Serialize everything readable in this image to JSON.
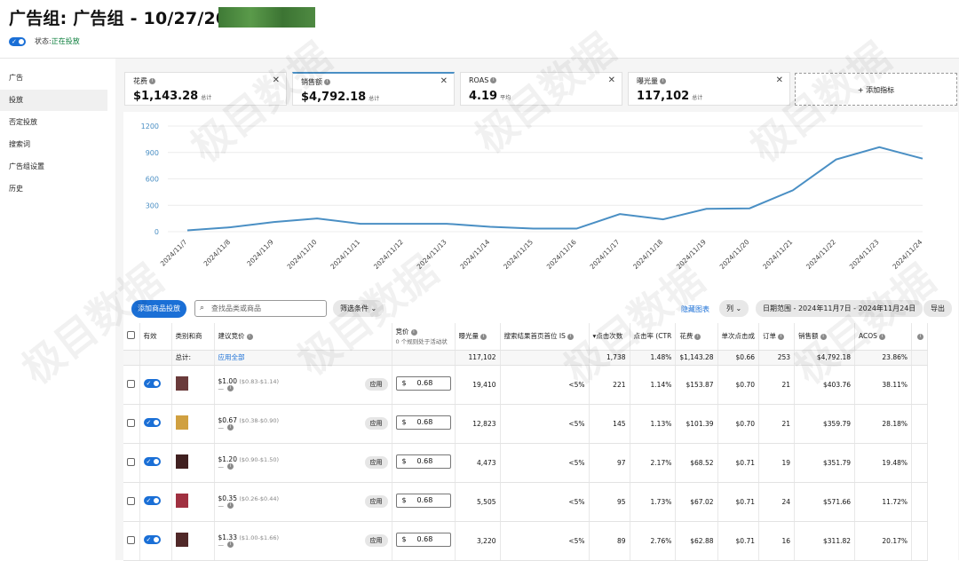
{
  "header": {
    "title": "广告组: 广告组 - 10/27/2024",
    "status_label": "状态:",
    "status_value": "正在投放"
  },
  "sidebar": {
    "items": [
      {
        "label": "广告",
        "active": false
      },
      {
        "label": "投放",
        "active": true
      },
      {
        "label": "否定投放",
        "active": false
      },
      {
        "label": "搜索词",
        "active": false
      },
      {
        "label": "广告组设置",
        "active": false
      },
      {
        "label": "历史",
        "active": false
      }
    ]
  },
  "metrics": [
    {
      "label": "花费",
      "value": "$1,143.28",
      "sub": "总计"
    },
    {
      "label": "销售额",
      "value": "$4,792.18",
      "sub": "总计"
    },
    {
      "label": "ROAS",
      "value": "4.19",
      "sub": "平均"
    },
    {
      "label": "曝光量",
      "value": "117,102",
      "sub": "总计"
    }
  ],
  "add_metric_label": "+ 添加指标",
  "chart_data": {
    "type": "line",
    "x": [
      "2024/11/7",
      "2024/11/8",
      "2024/11/9",
      "2024/11/10",
      "2024/11/11",
      "2024/11/12",
      "2024/11/13",
      "2024/11/14",
      "2024/11/15",
      "2024/11/16",
      "2024/11/17",
      "2024/11/18",
      "2024/11/19",
      "2024/11/20",
      "2024/11/21",
      "2024/11/22",
      "2024/11/23",
      "2024/11/24"
    ],
    "y_ticks": [
      "1200",
      "900",
      "600",
      "300",
      "0"
    ],
    "ylim": [
      0,
      1200
    ],
    "series": [
      {
        "values": [
          15,
          50,
          110,
          150,
          90,
          90,
          90,
          55,
          35,
          35,
          200,
          140,
          260,
          265,
          470,
          820,
          960,
          830
        ],
        "color": "#4a8fc4"
      }
    ],
    "grid": true
  },
  "toolbar": {
    "add_button": "添加商品投放",
    "search_placeholder": "查找品类或商品",
    "filter": "筛选条件",
    "hide_chart": "隐藏图表",
    "columns": "列",
    "date_range": "日期范围 - 2024年11月7日 - 2024年11月24日",
    "export": "导出"
  },
  "table": {
    "headers": {
      "active": "有效",
      "category": "类别和商",
      "suggested_bid": "建议竞价",
      "bid": "竞价",
      "bid_sub": "0 个规则处于活动状",
      "impressions": "曝光量",
      "top_is": "搜索结果首页首位 IS",
      "clicks": "点击次数",
      "ctr": "点击率 (CTR",
      "spend": "花费",
      "cpc": "单次点击成",
      "orders": "订单",
      "sales": "销售额",
      "acos": "ACOS"
    },
    "total": {
      "label": "总计:",
      "apply_all": "应用全部",
      "impressions": "117,102",
      "clicks": "1,738",
      "ctr": "1.48%",
      "spend": "$1,143.28",
      "cpc": "$0.66",
      "orders": "253",
      "sales": "$4,792.18",
      "acos": "23.86%"
    },
    "apply_label": "应用",
    "currency": "$",
    "suggest_more": "—",
    "rows": [
      {
        "sug": "$1.00",
        "range": "($0.83-$1.14)",
        "bid": "0.68",
        "impressions": "19,410",
        "top_is": "<5%",
        "clicks": "221",
        "ctr": "1.14%",
        "spend": "$153.87",
        "cpc": "$0.70",
        "orders": "21",
        "sales": "$403.76",
        "acos": "38.11%",
        "thumb": "#6a3a3a"
      },
      {
        "sug": "$0.67",
        "range": "($0.38-$0.90)",
        "bid": "0.68",
        "impressions": "12,823",
        "top_is": "<5%",
        "clicks": "145",
        "ctr": "1.13%",
        "spend": "$101.39",
        "cpc": "$0.70",
        "orders": "21",
        "sales": "$359.79",
        "acos": "28.18%",
        "thumb": "#d0a040"
      },
      {
        "sug": "$1.20",
        "range": "($0.90-$1.50)",
        "bid": "0.68",
        "impressions": "4,473",
        "top_is": "<5%",
        "clicks": "97",
        "ctr": "2.17%",
        "spend": "$68.52",
        "cpc": "$0.71",
        "orders": "19",
        "sales": "$351.79",
        "acos": "19.48%",
        "thumb": "#402020"
      },
      {
        "sug": "$0.35",
        "range": "($0.26-$0.44)",
        "bid": "0.68",
        "impressions": "5,505",
        "top_is": "<5%",
        "clicks": "95",
        "ctr": "1.73%",
        "spend": "$67.02",
        "cpc": "$0.71",
        "orders": "24",
        "sales": "$571.66",
        "acos": "11.72%",
        "thumb": "#a03040"
      },
      {
        "sug": "$1.33",
        "range": "($1.00-$1.66)",
        "bid": "0.68",
        "impressions": "3,220",
        "top_is": "<5%",
        "clicks": "89",
        "ctr": "2.76%",
        "spend": "$62.88",
        "cpc": "$0.71",
        "orders": "16",
        "sales": "$311.82",
        "acos": "20.17%",
        "thumb": "#502828"
      }
    ]
  },
  "watermark_text": "极目数据"
}
